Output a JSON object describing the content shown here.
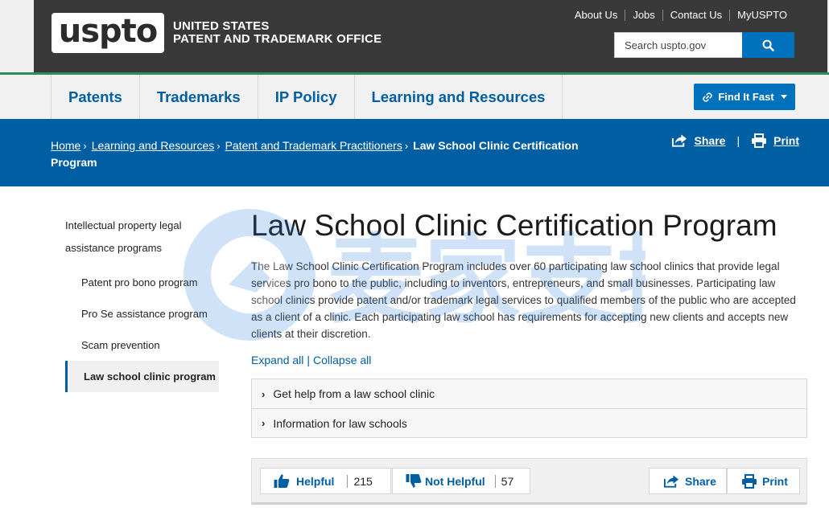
{
  "header": {
    "logo_text": "uspto",
    "agency_line1": "UNITED STATES",
    "agency_line2": "PATENT AND TRADEMARK OFFICE",
    "utility_links": [
      "About Us",
      "Jobs",
      "Contact Us",
      "MyUSPTO"
    ],
    "search_placeholder": "Search uspto.gov"
  },
  "nav": {
    "items": [
      "Patents",
      "Trademarks",
      "IP Policy",
      "Learning and Resources"
    ],
    "find_it_fast": "Find It Fast"
  },
  "breadcrumb": {
    "items": [
      "Home",
      "Learning and Resources",
      "Patent and Trademark Practitioners"
    ],
    "current": "Law School Clinic Certification Program",
    "share": "Share",
    "separator": "|",
    "print": "Print"
  },
  "sidebar": {
    "parent": "Intellectual property legal assistance programs",
    "items": [
      "Patent pro bono program",
      "Pro Se assistance program",
      "Scam prevention",
      "Law school clinic program"
    ],
    "active_index": 3
  },
  "main": {
    "title": "Law School Clinic Certification Program",
    "intro": "The Law School Clinic Certification Program includes over 60 participating law school clinics that provide legal services pro bono to the public, including to inventors, entrepreneurs, and small businesses. Participating law school clinics provide patent and/or trademark legal services to qualified members of the public who are accepted as a client of a clinic. Each participating law school has requirements for accepting new clients and accepts new clients at their discretion.",
    "expand_all": "Expand all",
    "expand_sep": "|",
    "collapse_all": "Collapse all",
    "accordion": [
      "Get help from a law school clinic",
      "Information for law schools"
    ]
  },
  "feedback": {
    "helpful_label": "Helpful",
    "helpful_count": "215",
    "not_helpful_label": "Not Helpful",
    "not_helpful_count": "57",
    "share": "Share",
    "print": "Print"
  },
  "watermark": {
    "text": "麦家支持"
  },
  "colors": {
    "header_dark": "#393939",
    "brand_blue": "#005ea2",
    "button_blue": "#0071bc",
    "accent_green": "#2f8c57"
  },
  "icons": [
    "search-icon",
    "link-icon",
    "share-icon",
    "print-icon",
    "thumbs-up-icon",
    "thumbs-down-icon",
    "chevron-right-icon",
    "caret-down-icon"
  ]
}
